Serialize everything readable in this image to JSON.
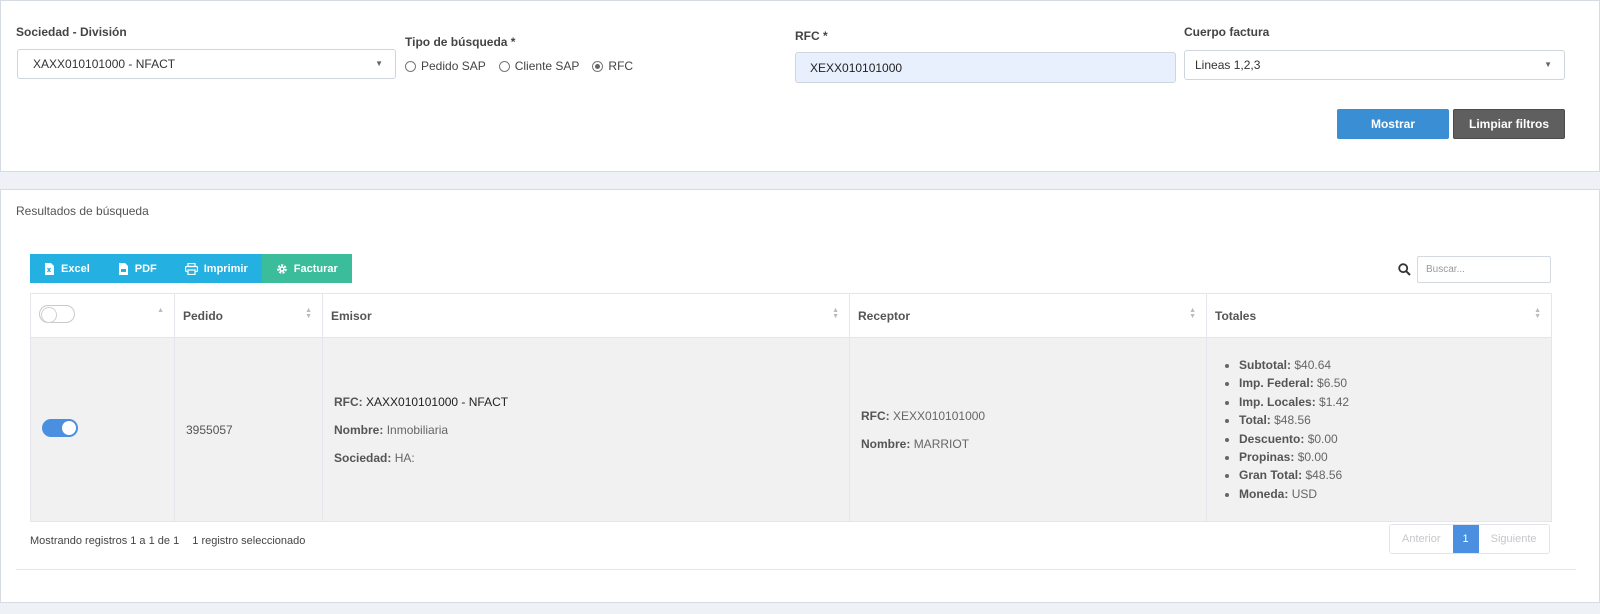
{
  "filters": {
    "sociedad_label": "Sociedad - División",
    "sociedad_value": "XAXX010101000 - NFACT",
    "tipo_label": "Tipo de búsqueda *",
    "tipo_options": [
      "Pedido SAP",
      "Cliente SAP",
      "RFC"
    ],
    "tipo_selected": "RFC",
    "rfc_label": "RFC *",
    "rfc_value": "XEXX010101000",
    "cuerpo_label": "Cuerpo factura",
    "cuerpo_value": "Lineas 1,2,3",
    "mostrar_label": "Mostrar",
    "limpiar_label": "Limpiar filtros"
  },
  "results": {
    "title": "Resultados de búsqueda",
    "toolbar": {
      "excel": "Excel",
      "pdf": "PDF",
      "imprimir": "Imprimir",
      "facturar": "Facturar"
    },
    "search_placeholder": "Buscar...",
    "columns": [
      "Pedido",
      "Emisor",
      "Receptor",
      "Totales"
    ],
    "row": {
      "selected": true,
      "pedido": "3955057",
      "emisor": {
        "rfc_label": "RFC:",
        "rfc": "XAXX010101000 - NFACT",
        "nombre_label": "Nombre:",
        "nombre": "Inmobiliaria",
        "sociedad_label": "Sociedad:",
        "sociedad": "HA:"
      },
      "receptor": {
        "rfc_label": "RFC:",
        "rfc": "XEXX010101000",
        "nombre_label": "Nombre:",
        "nombre": "MARRIOT"
      },
      "totales": [
        {
          "label": "Subtotal:",
          "value": "$40.64"
        },
        {
          "label": "Imp. Federal:",
          "value": "$6.50"
        },
        {
          "label": "Imp. Locales:",
          "value": "$1.42"
        },
        {
          "label": "Total:",
          "value": "$48.56"
        },
        {
          "label": "Descuento:",
          "value": "$0.00"
        },
        {
          "label": "Propinas:",
          "value": "$0.00"
        },
        {
          "label": "Gran Total:",
          "value": "$48.56"
        },
        {
          "label": "Moneda:",
          "value": "USD"
        }
      ]
    },
    "footer_info": "Mostrando registros 1 a 1 de 1",
    "footer_selected": "1 registro seleccionado",
    "pager": {
      "prev": "Anterior",
      "current": "1",
      "next": "Siguiente"
    }
  },
  "colors": {
    "primary": "#3a8fd4",
    "toolbar_blue": "#24b0e0",
    "toolbar_green": "#3bbc9b",
    "dark_button": "#5f5f5f",
    "switch_on": "#4a8fe0"
  }
}
